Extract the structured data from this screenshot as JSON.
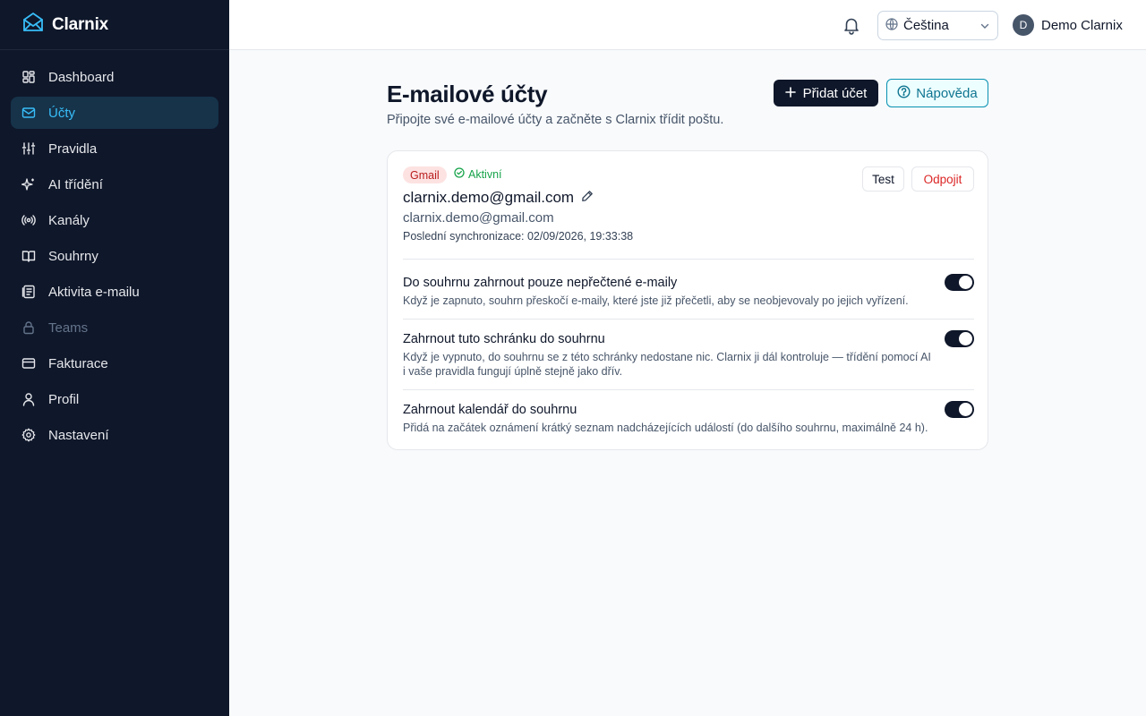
{
  "brand": {
    "name": "Clarnix"
  },
  "sidebar": {
    "items": [
      {
        "label": "Dashboard",
        "icon": "dashboard-icon"
      },
      {
        "label": "Účty",
        "icon": "mail-icon",
        "active": true
      },
      {
        "label": "Pravidla",
        "icon": "sliders-icon"
      },
      {
        "label": "AI třídění",
        "icon": "sparkles-icon"
      },
      {
        "label": "Kanály",
        "icon": "radio-icon"
      },
      {
        "label": "Souhrny",
        "icon": "book-icon"
      },
      {
        "label": "Aktivita e-mailu",
        "icon": "activity-list-icon"
      },
      {
        "label": "Teams",
        "icon": "lock-icon",
        "disabled": true
      },
      {
        "label": "Fakturace",
        "icon": "credit-card-icon"
      },
      {
        "label": "Profil",
        "icon": "user-icon"
      },
      {
        "label": "Nastavení",
        "icon": "gear-icon"
      }
    ]
  },
  "header": {
    "language": "Čeština",
    "user": {
      "initial": "D",
      "name": "Demo Clarnix"
    }
  },
  "main": {
    "title": "E-mailové účty",
    "subtitle": "Připojte své e-mailové účty a začněte s Clarnix třídit poštu.",
    "add_button": "Přidat účet",
    "help_button": "Nápověda"
  },
  "account": {
    "provider": "Gmail",
    "status": "Aktivní",
    "email": "clarnix.demo@gmail.com",
    "email_secondary": "clarnix.demo@gmail.com",
    "last_sync": "Poslední synchronizace: 02/09/2026, 19:33:38",
    "test_button": "Test",
    "disconnect_button": "Odpojit",
    "settings": [
      {
        "title": "Do souhrnu zahrnout pouze nepřečtené e-maily",
        "description": "Když je zapnuto, souhrn přeskočí e-maily, které jste již přečetli, aby se neobjevovaly po jejich vyřízení.",
        "enabled": true
      },
      {
        "title": "Zahrnout tuto schránku do souhrnu",
        "description": "Když je vypnuto, do souhrnu se z této schránky nedostane nic. Clarnix ji dál kontroluje — třídění pomocí AI i vaše pravidla fungují úplně stejně jako dřív.",
        "enabled": true
      },
      {
        "title": "Zahrnout kalendář do souhrnu",
        "description": "Přidá na začátek oznámení krátký seznam nadcházejících událostí (do dalšího souhrnu, maximálně 24 h).",
        "enabled": true
      }
    ]
  },
  "colors": {
    "sidebar_bg": "#0f172a",
    "active_item_bg": "#16334a",
    "accent": "#38bdf8",
    "primary_button": "#0f172a",
    "danger": "#dc2626",
    "success": "#16a34a"
  }
}
